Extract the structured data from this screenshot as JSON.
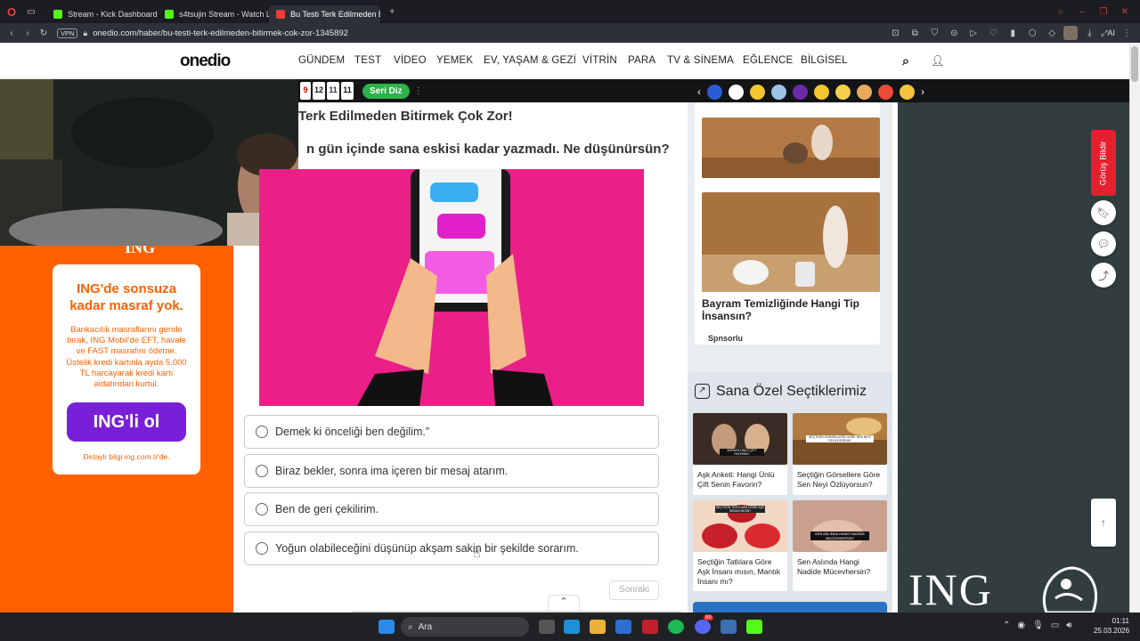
{
  "browser": {
    "tabs": [
      {
        "title": "Stream - Kick Dashboard",
        "color": "#53fc18"
      },
      {
        "title": "s4tsujin Stream - Watch L",
        "color": "#53fc18"
      },
      {
        "title": "Bu Testi Terk Edilmeden Bi",
        "color": "#e8403a"
      }
    ],
    "vpn_label": "VPN",
    "url": "onedio.com/haber/bu-testi-terk-edilmeden-bitirmek-cok-zor-1345892",
    "ai_label": "AI"
  },
  "site": {
    "logo": "onedio",
    "nav": [
      "GÜNDEM",
      "TEST",
      "VİDEO",
      "YEMEK",
      "EV, YAŞAM & GEZİ",
      "VİTRİN",
      "PARA",
      "TV & SİNEMA",
      "EĞLENCE",
      "BİLGİSEL"
    ]
  },
  "game_widget": {
    "numbers": [
      "9",
      "12",
      "11",
      "11"
    ],
    "button": "Seri Diz"
  },
  "quiz": {
    "title": "Terk Edilmeden Bitirmek Çok Zor!",
    "question": "n gün içinde sana eskisi kadar yazmadı. Ne düşünürsün?",
    "options": [
      "Demek ki önceliği ben değilim.”",
      "Biraz bekler, sonra ima içeren bir mesaj atarım.",
      "Ben de geri çekilirim.",
      "Yoğun olabileceğini düşünüp akşam sakin bir şekilde sorarım."
    ],
    "next_button": "Sonraki"
  },
  "ad_left": {
    "logo": "ING",
    "headline": "ING'de sonsuza kadar masraf yok.",
    "body": "Bankacılık masraflarını geride bırak, ING Mobil'de EFT, havale ve FAST masrafını ödeme. Üstelik kredi kartınla ayda 5.000 TL harcayarak kredi kartı aidatından kurtul.",
    "cta": "ING'li ol",
    "footer": "Detaylı bilgi ing.com.tr'de."
  },
  "sponsored": {
    "title": "Bayram Temizliğinde Hangi Tip İnsansın?",
    "label": "Spnsorlu"
  },
  "picks": {
    "heading": "Sana Özel Seçtiklerimiz",
    "items": [
      {
        "title": "Aşk Anketi: Hangi Ünlü Çift Senin Favorin?",
        "overlay": "BURAYA ÜNLÜ ÇİFT FAVORİN?"
      },
      {
        "title": "Seçtiğin Görsellere Göre Sen Neyi Özlüyorsun?",
        "overlay": "SEÇTİĞİN GÖRSELLERE GÖRE SEN NEYİ ÖZLÜYORSUN?"
      },
      {
        "title": "Seçtiğin Tatlılara Göre Aşk İnsanı mısın, Mantık İnsanı mı?",
        "overlay": "SEÇTİĞİN TATLILARA GÖRE AŞK İNSANI MISIN?"
      },
      {
        "title": "Sen Aslında Hangi Nadide Mücevhersin?",
        "overlay": "SEN ASLINDA HANGİ NADİDE MÜCEVHERSİN?"
      }
    ]
  },
  "side_actions": {
    "feedback": "Görüş Bildir"
  },
  "ad_right": {
    "logo": "ING"
  },
  "taskbar": {
    "search": "Ara",
    "time": "01:11",
    "date": "25.03.2026",
    "badge": "99"
  },
  "colors": {
    "ing_orange": "#ff6100",
    "ing_purple": "#7a1fd8",
    "accent_green": "#2db14a",
    "feedback_red": "#e4202e",
    "right_ad_bg": "#323d3f"
  }
}
